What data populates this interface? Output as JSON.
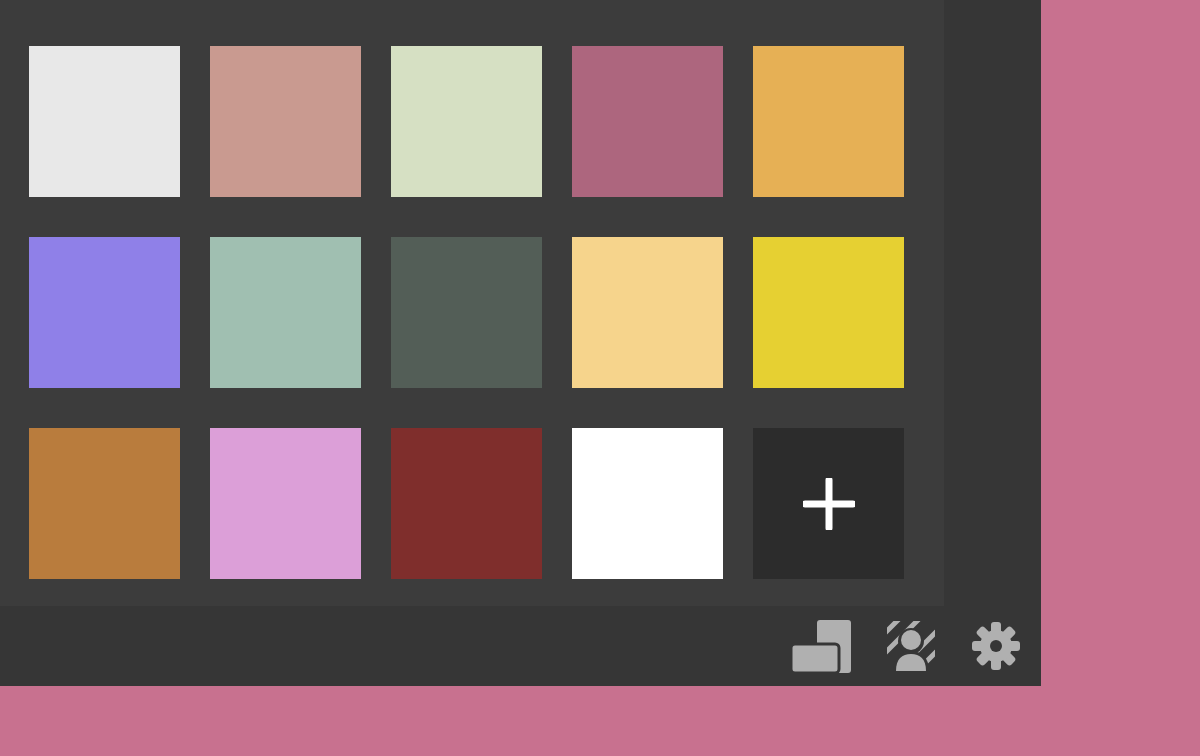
{
  "swatches": [
    {
      "color": "#e8e8e8"
    },
    {
      "color": "#c99a90"
    },
    {
      "color": "#d6e0c3"
    },
    {
      "color": "#ad667e"
    },
    {
      "color": "#e6b055"
    },
    {
      "color": "#8f80e8"
    },
    {
      "color": "#a0bfb1"
    },
    {
      "color": "#535e57"
    },
    {
      "color": "#f6d48c"
    },
    {
      "color": "#e6d032"
    },
    {
      "color": "#b97c3d"
    },
    {
      "color": "#dc9fd8"
    },
    {
      "color": "#7f2e2c"
    },
    {
      "color": "#ffffff"
    }
  ]
}
